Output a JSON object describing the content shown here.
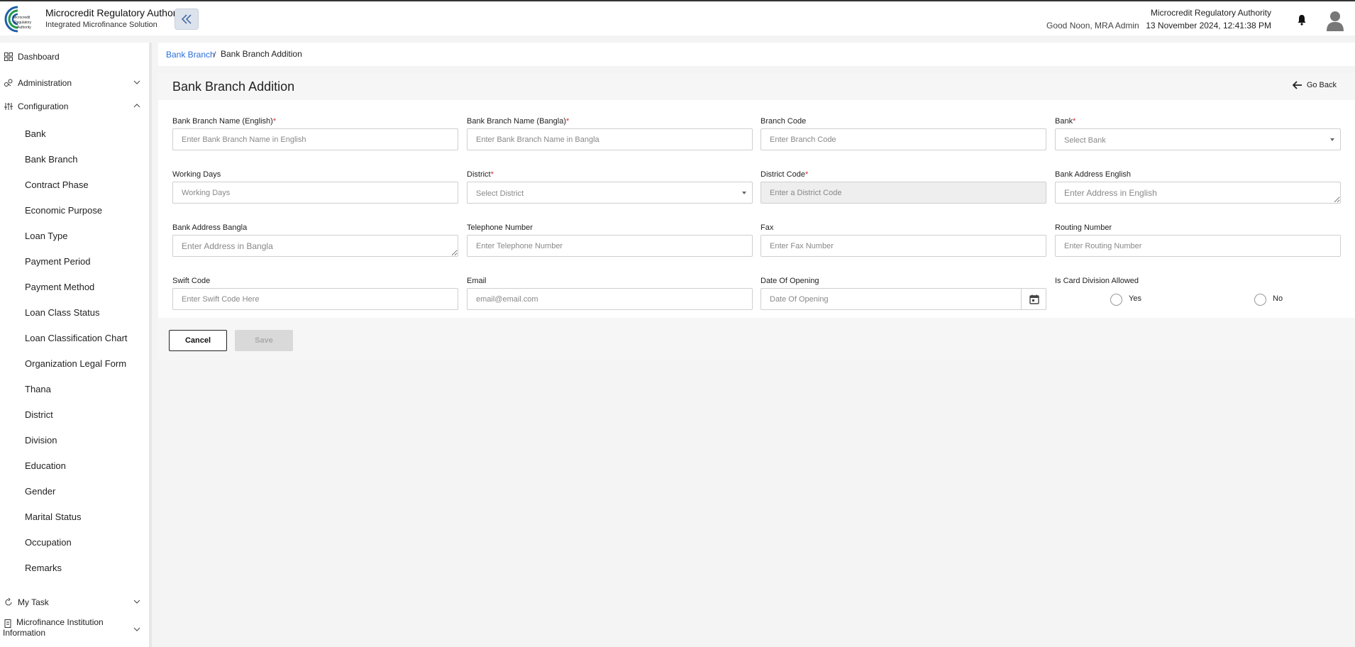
{
  "header": {
    "org_title": "Microcredit Regulatory Authority",
    "org_subtitle": "Integrated Microfinance Solution",
    "logo_text": "Microcredit Regulatory Authority",
    "greeting": "Good Noon, MRA Admin",
    "right_org": "Microcredit Regulatory Authority",
    "datetime": "13 November 2024, 12:41:38 PM"
  },
  "sidebar": {
    "dashboard": "Dashboard",
    "administration": "Administration",
    "configuration": "Configuration",
    "config_items": [
      "Bank",
      "Bank Branch",
      "Contract Phase",
      "Economic Purpose",
      "Loan Type",
      "Payment Period",
      "Payment Method",
      "Loan Class Status",
      "Loan Classification Chart",
      "Organization Legal Form",
      "Thana",
      "District",
      "Division",
      "Education",
      "Gender",
      "Marital Status",
      "Occupation",
      "Remarks"
    ],
    "my_task": "My Task",
    "mfi_info": "Microfinance Institution Information"
  },
  "breadcrumb": {
    "link": "Bank Branch",
    "separator": "/",
    "current": "Bank Branch Addition"
  },
  "page": {
    "title": "Bank Branch Addition",
    "go_back": "Go Back"
  },
  "form": {
    "branch_name_en": {
      "label": "Bank Branch Name (English)",
      "placeholder": "Enter Bank Branch Name in English"
    },
    "branch_name_bn": {
      "label": "Bank Branch Name (Bangla)",
      "placeholder": "Enter Bank Branch Name in Bangla"
    },
    "branch_code": {
      "label": "Branch Code",
      "placeholder": "Enter Branch Code"
    },
    "bank": {
      "label": "Bank",
      "placeholder": "Select Bank"
    },
    "working_days": {
      "label": "Working Days",
      "placeholder": "Working Days"
    },
    "district": {
      "label": "District",
      "placeholder": "Select District"
    },
    "district_code": {
      "label": "District Code",
      "placeholder": "Enter a District Code"
    },
    "address_en": {
      "label": "Bank Address English",
      "placeholder": "Enter Address in English"
    },
    "address_bn": {
      "label": "Bank Address Bangla",
      "placeholder": "Enter Address in Bangla"
    },
    "telephone": {
      "label": "Telephone Number",
      "placeholder": "Enter Telephone Number"
    },
    "fax": {
      "label": "Fax",
      "placeholder": "Enter Fax Number"
    },
    "routing": {
      "label": "Routing Number",
      "placeholder": "Enter Routing Number"
    },
    "swift": {
      "label": "Swift Code",
      "placeholder": "Enter Swift Code Here"
    },
    "email": {
      "label": "Email",
      "placeholder": "email@email.com"
    },
    "date_opening": {
      "label": "Date Of Opening",
      "placeholder": "Date Of Opening"
    },
    "card_division": {
      "label": "Is Card Division Allowed",
      "yes": "Yes",
      "no": "No"
    },
    "required_mark": "*"
  },
  "actions": {
    "cancel": "Cancel",
    "save": "Save"
  },
  "colors": {
    "link": "#2a6fdb",
    "required": "#d32f2f",
    "logo_green": "#1f9a4a",
    "logo_blue": "#1d5fa8"
  }
}
